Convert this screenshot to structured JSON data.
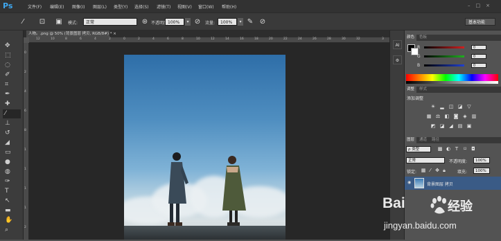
{
  "app": {
    "logo": "Ps"
  },
  "menu": [
    "文件(F)",
    "编辑(E)",
    "图像(I)",
    "图层(L)",
    "类型(Y)",
    "选择(S)",
    "滤镜(T)",
    "视图(V)",
    "窗口(W)",
    "帮助(H)"
  ],
  "window_controls": "–□×",
  "options": {
    "mode_label": "模式:",
    "mode_value": "正常",
    "opacity_label": "不透明度:",
    "opacity_value": "100%",
    "flow_label": "流量:",
    "flow_value": "100%",
    "workspace": "基本功能"
  },
  "document": {
    "tab_title": "人物。.png @ 50% (背景图层 拷贝, RGB/8#) * ×",
    "ruler_h": [
      "12",
      "10",
      "8",
      "6",
      "4",
      "2",
      "0",
      "2",
      "4",
      "6",
      "8",
      "10",
      "12",
      "14",
      "16",
      "18",
      "20",
      "22",
      "24",
      "26",
      "28",
      "30",
      "32",
      "3"
    ],
    "ruler_v": [
      "0",
      "2",
      "4",
      "6",
      "8",
      "1",
      "1",
      "1",
      "1",
      "2"
    ]
  },
  "color_panel": {
    "tabs": [
      "颜色",
      "色板"
    ],
    "r_label": "R",
    "g_label": "G",
    "b_label": "B",
    "r_value": "0",
    "g_value": "0",
    "b_value": "0",
    "colors": {
      "r": "#d02020",
      "g": "#20b020",
      "b": "#2040d0"
    }
  },
  "adjust_panel": {
    "tabs": [
      "调整",
      "样式"
    ],
    "title": "添加调整"
  },
  "layers_panel": {
    "tabs": [
      "图层",
      "通道",
      "路径"
    ],
    "filter_label": "ρ 类型",
    "blend_mode": "正常",
    "opacity_label": "不透明度:",
    "opacity_value": "100%",
    "lock_label": "锁定:",
    "fill_label": "填充:",
    "fill_value": "100%",
    "layer_name": "背景图层 拷贝"
  },
  "strip": {
    "icon1": "AI",
    "icon2": "⚙"
  },
  "watermark": {
    "brand_a": "Bai",
    "brand_b": "经验",
    "url": "jingyan.baidu.com"
  }
}
